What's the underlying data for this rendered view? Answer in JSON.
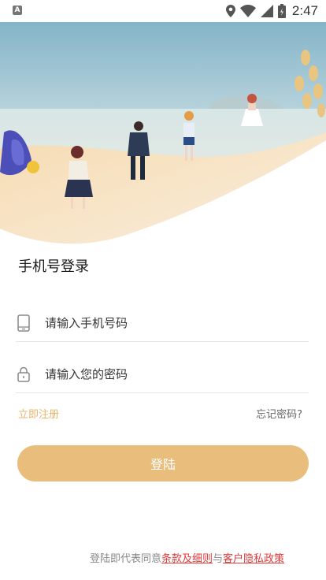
{
  "status_bar": {
    "app_icon_letter": "A",
    "time": "2:47"
  },
  "login": {
    "title": "手机号登录",
    "phone_placeholder": "请输入手机号码",
    "password_placeholder": "请输入您的密码",
    "register_label": "立即注册",
    "forgot_label": "忘记密码?",
    "submit_label": "登陆"
  },
  "agreement": {
    "prefix": "登陆即代表同意",
    "terms_link": "条款及细则",
    "connector": "与",
    "privacy_link": "客户隐私政策"
  },
  "colors": {
    "accent": "#e9bd7b",
    "link_accent": "#e4b46e",
    "agreement_link": "#e03b3b"
  },
  "icons": [
    "signal-indicator-icon",
    "location-icon",
    "wifi-icon",
    "cellular-signal-icon",
    "battery-icon",
    "phone-icon",
    "lock-icon"
  ]
}
